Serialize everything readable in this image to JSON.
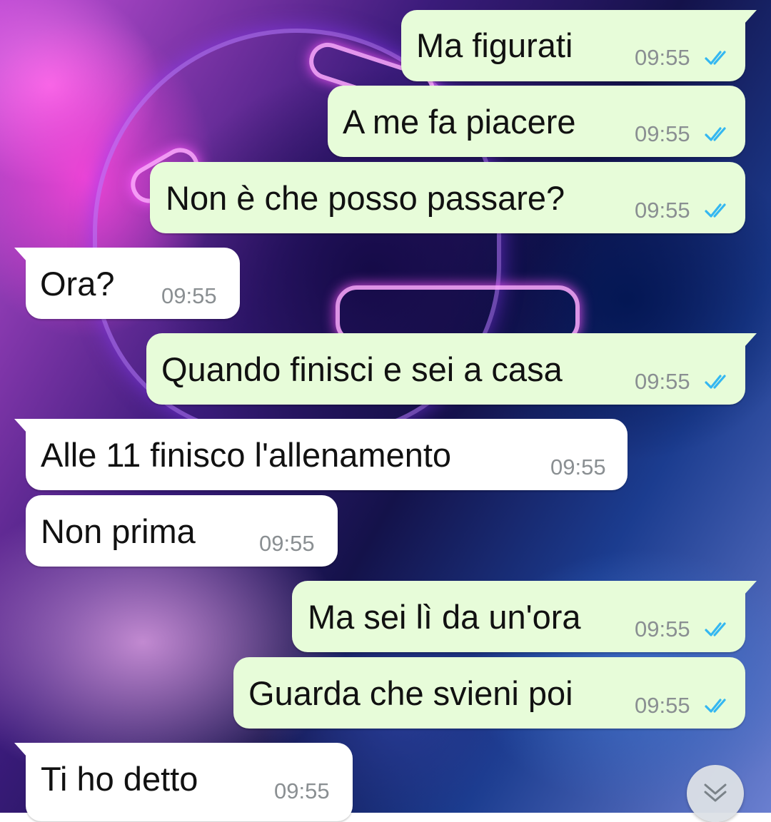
{
  "theme": {
    "outgoing_bubble": "#e7fcd9",
    "incoming_bubble": "#ffffff",
    "read_ticks": "#34b7f1",
    "time_text": "#8a8f92"
  },
  "messages": [
    {
      "direction": "out",
      "text": "Ma figurati",
      "time": "09:55",
      "status": "read"
    },
    {
      "direction": "out",
      "text": "A me fa piacere",
      "time": "09:55",
      "status": "read"
    },
    {
      "direction": "out",
      "text": "Non è che posso passare?",
      "time": "09:55",
      "status": "read"
    },
    {
      "direction": "in",
      "text": "Ora?",
      "time": "09:55"
    },
    {
      "direction": "out",
      "text": "Quando finisci e sei a casa",
      "time": "09:55",
      "status": "read"
    },
    {
      "direction": "in",
      "text": "Alle 11 finisco l'allenamento",
      "time": "09:55"
    },
    {
      "direction": "in",
      "text": "Non prima",
      "time": "09:55"
    },
    {
      "direction": "out",
      "text": "Ma sei lì da un'ora",
      "time": "09:55",
      "status": "read"
    },
    {
      "direction": "out",
      "text": "Guarda che svieni poi",
      "time": "09:55",
      "status": "read"
    },
    {
      "direction": "in",
      "text": "Ti ho detto",
      "time": "09:55"
    }
  ],
  "scroll_button": {
    "icon": "double-chevron-down-icon"
  }
}
